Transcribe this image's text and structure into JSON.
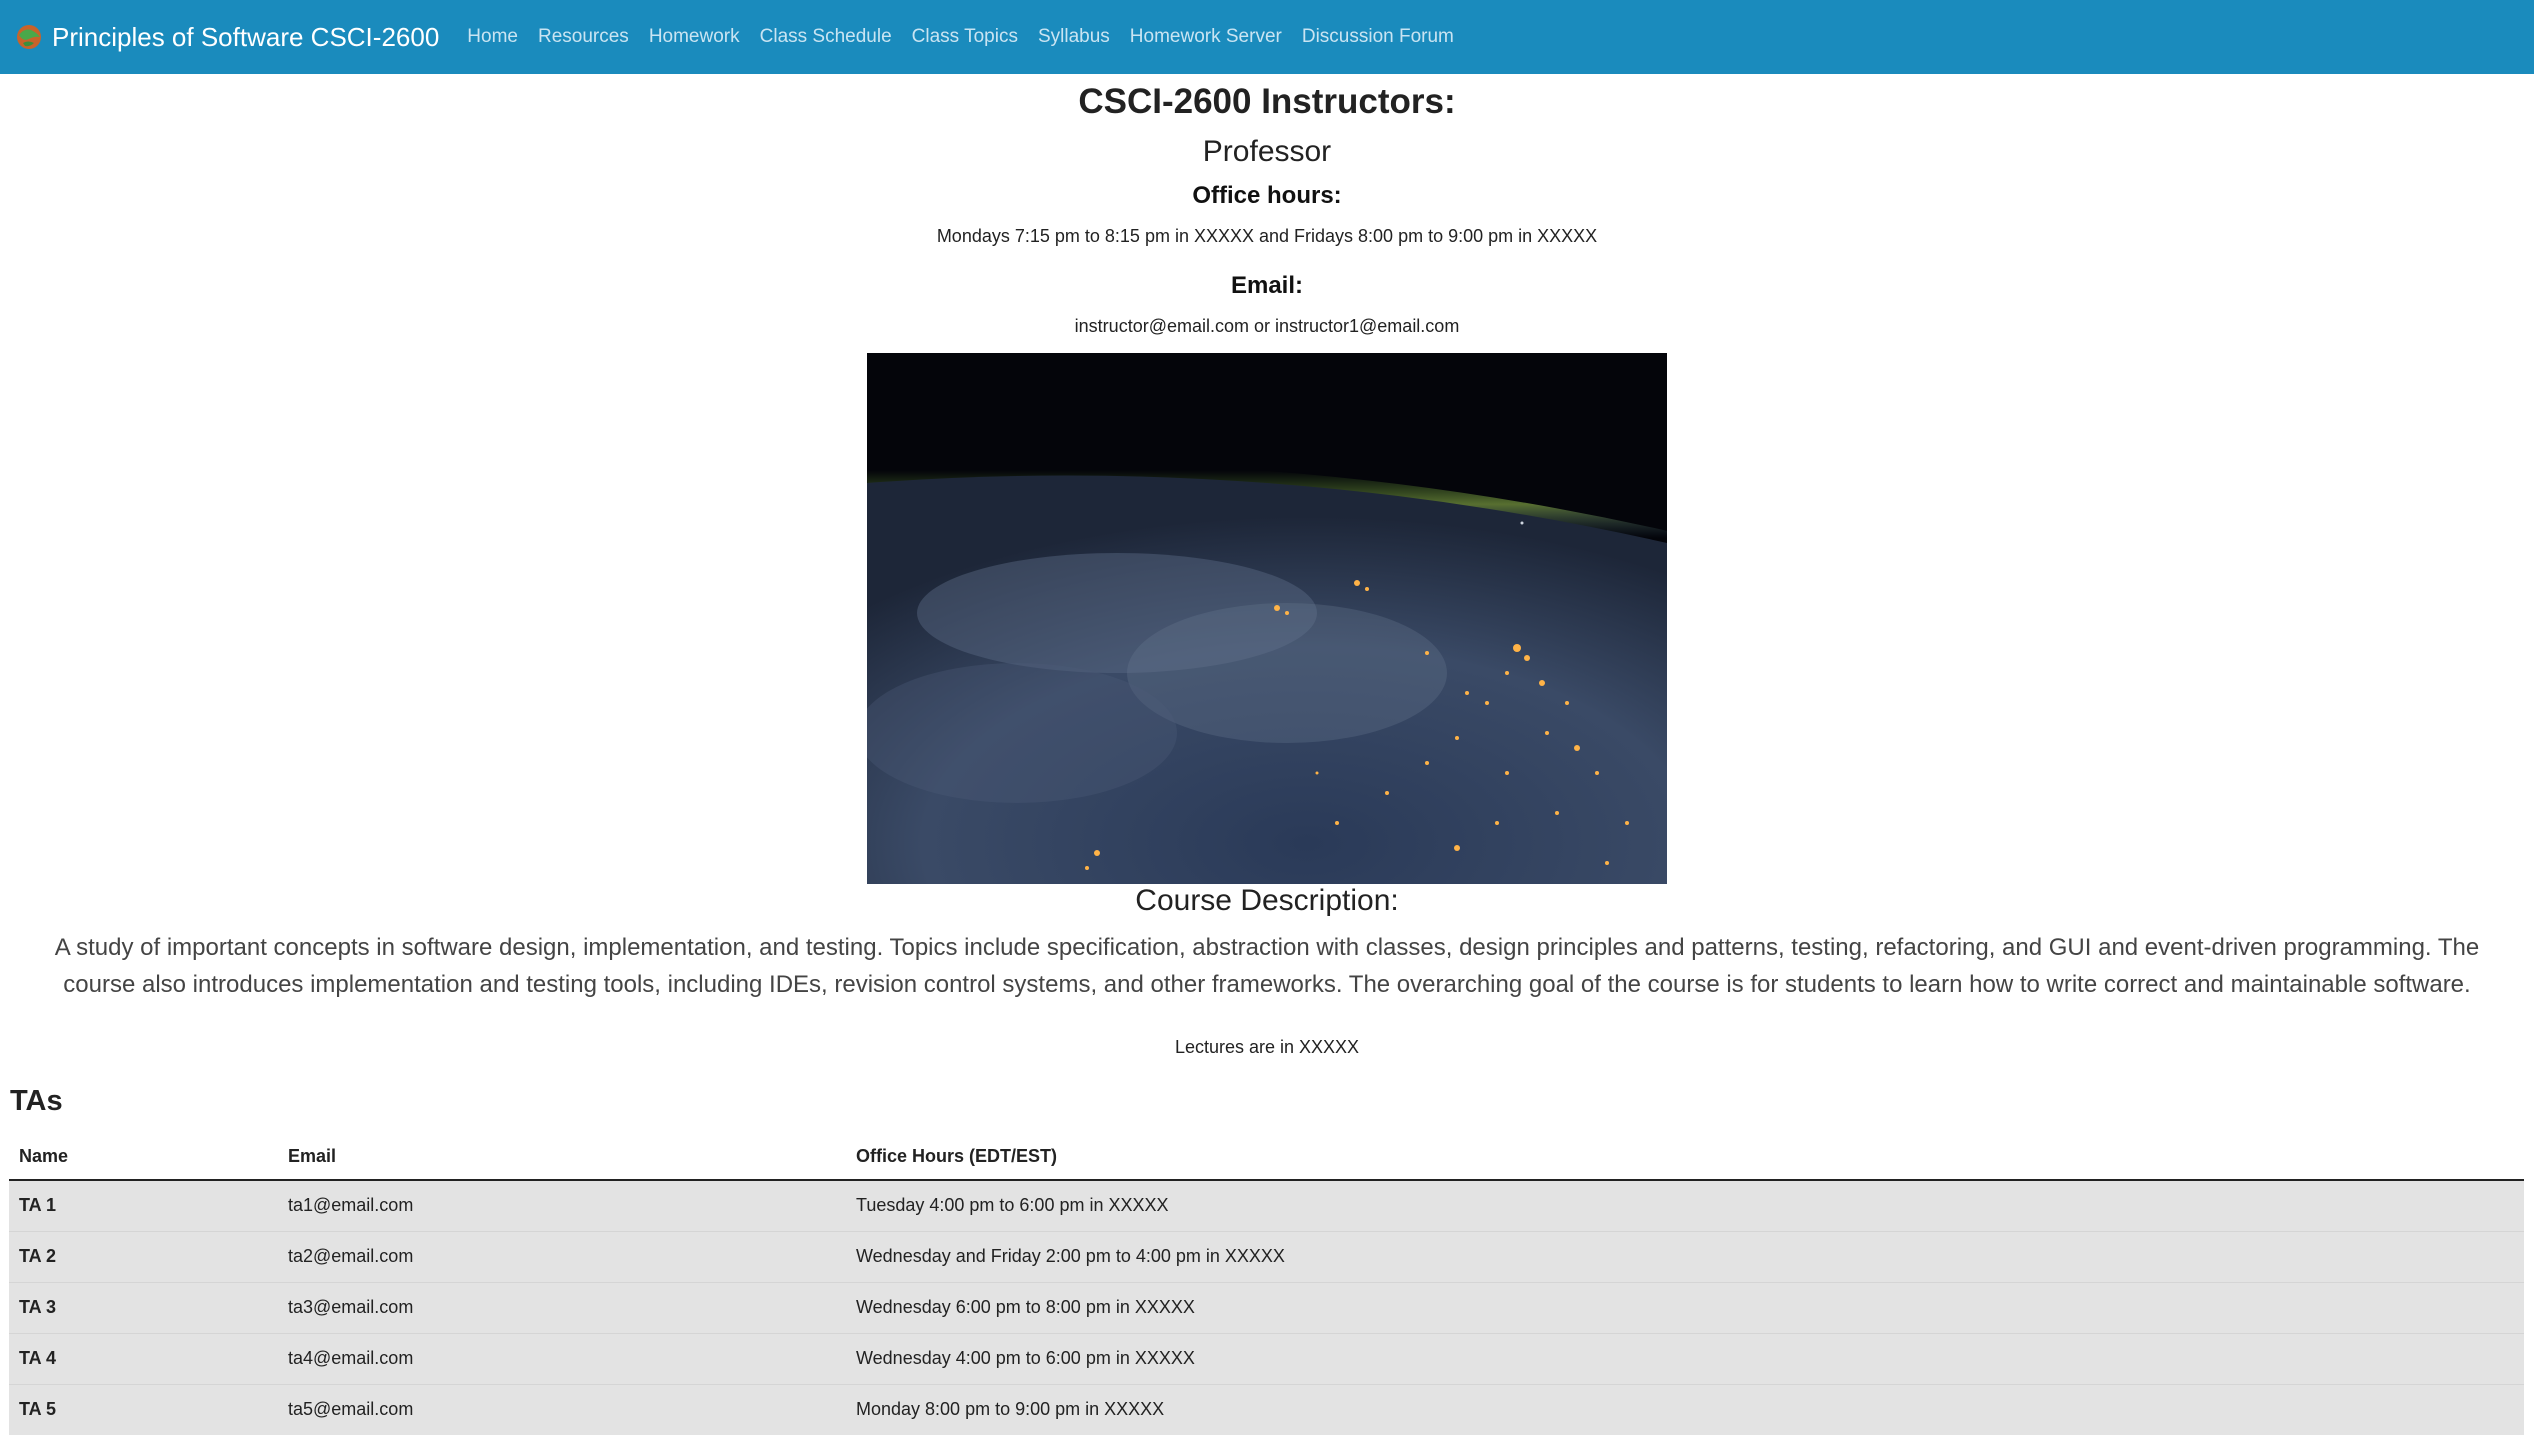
{
  "navbar": {
    "brand": "Principles of Software CSCI-2600",
    "items": [
      {
        "label": "Home"
      },
      {
        "label": "Resources"
      },
      {
        "label": "Homework"
      },
      {
        "label": "Class Schedule"
      },
      {
        "label": "Class Topics"
      },
      {
        "label": "Syllabus"
      },
      {
        "label": "Homework Server"
      },
      {
        "label": "Discussion Forum"
      }
    ]
  },
  "instructors": {
    "title": "CSCI-2600 Instructors:",
    "role": "Professor",
    "office_hours_heading": "Office hours:",
    "office_hours": "Mondays 7:15 pm to 8:15 pm in XXXXX and Fridays 8:00 pm to 9:00 pm in XXXXX",
    "email_heading": "Email:",
    "email": "instructor@email.com or instructor1@email.com"
  },
  "course": {
    "description_title": "Course Description:",
    "description": "A study of important concepts in software design, implementation, and testing. Topics include specification, abstraction with classes, design principles and patterns, testing, refactoring, and GUI and event-driven programming. The course also introduces implementation and testing tools, including IDEs, revision control systems, and other frameworks. The overarching goal of the course is for students to learn how to write correct and maintainable software.",
    "lectures": "Lectures are in XXXXX"
  },
  "tas": {
    "title": "TAs",
    "headers": {
      "name": "Name",
      "email": "Email",
      "office_hours": "Office Hours (EDT/EST)"
    },
    "rows": [
      {
        "name": "TA 1",
        "email": "ta1@email.com",
        "office_hours": "Tuesday 4:00 pm to 6:00 pm in XXXXX"
      },
      {
        "name": "TA 2",
        "email": "ta2@email.com",
        "office_hours": "Wednesday and Friday 2:00 pm to 4:00 pm in XXXXX"
      },
      {
        "name": "TA 3",
        "email": "ta3@email.com",
        "office_hours": "Wednesday 6:00 pm to 8:00 pm in XXXXX"
      },
      {
        "name": "TA 4",
        "email": "ta4@email.com",
        "office_hours": "Wednesday 4:00 pm to 6:00 pm in XXXXX"
      },
      {
        "name": "TA 5",
        "email": "ta5@email.com",
        "office_hours": "Monday 8:00 pm to 9:00 pm in XXXXX"
      }
    ]
  },
  "colors": {
    "navbar_bg": "#1a8bbd",
    "nav_link": "#c9e4f2",
    "table_row_bg": "#e3e3e3"
  }
}
